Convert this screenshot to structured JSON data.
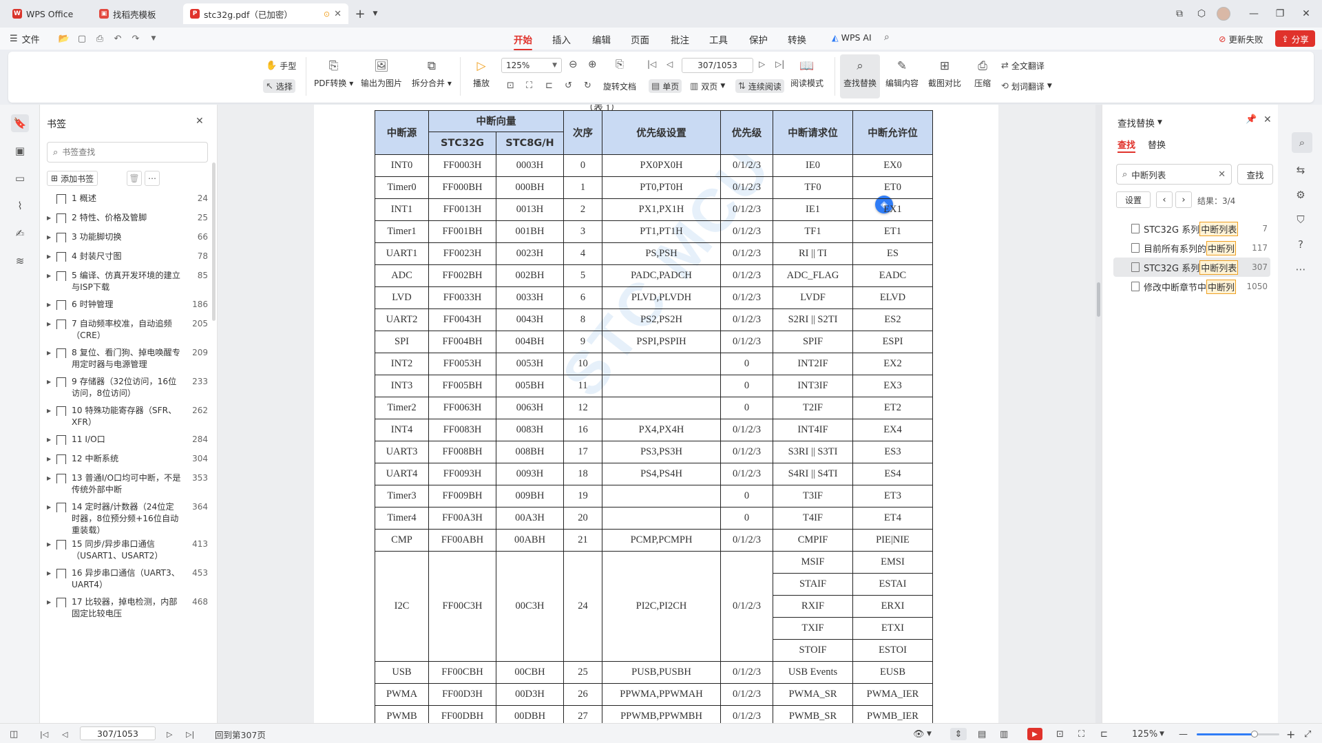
{
  "tabs": [
    {
      "label": "WPS Office",
      "icon": "wps-logo"
    },
    {
      "label": "找稻壳模板",
      "icon": "docer-logo"
    },
    {
      "label": "stc32g.pdf（已加密）",
      "icon": "pdf-logo"
    }
  ],
  "window": {
    "new_tab": "+"
  },
  "menubar": {
    "file": "文件",
    "items": [
      "开始",
      "插入",
      "编辑",
      "页面",
      "批注",
      "工具",
      "保护",
      "转换"
    ],
    "active": "开始",
    "wps_ai": "WPS AI",
    "update_failed": "更新失败",
    "share": "分享"
  },
  "ribbon": {
    "hand": "手型",
    "select": "选择",
    "pdf_convert": "PDF转换",
    "export_image": "输出为图片",
    "split_merge": "拆分合并",
    "play": "播放",
    "zoom": "125%",
    "page_field": "307/1053",
    "rotate": "旋转文档",
    "single_page": "单页",
    "double_page": "双页",
    "continuous": "连续阅读",
    "read_mode": "阅读模式",
    "find_replace": "查找替换",
    "edit_content": "编辑内容",
    "screenshot_compare": "截图对比",
    "compress": "压缩",
    "full_translate": "全文翻译",
    "word_translate": "划词翻译"
  },
  "bookmarks": {
    "title": "书签",
    "search_placeholder": "书签查找",
    "add": "添加书签",
    "items": [
      {
        "label": "1 概述",
        "page": "24",
        "expandable": false
      },
      {
        "label": "2 特性、价格及管脚",
        "page": "25",
        "expandable": true
      },
      {
        "label": "3 功能脚切换",
        "page": "66",
        "expandable": true
      },
      {
        "label": "4 封装尺寸图",
        "page": "78",
        "expandable": true
      },
      {
        "label": "5 编译、仿真开发环境的建立与ISP下载",
        "page": "85",
        "expandable": true
      },
      {
        "label": "6 时钟管理",
        "page": "186",
        "expandable": true
      },
      {
        "label": "7 自动频率校准，自动追频（CRE）",
        "page": "205",
        "expandable": true
      },
      {
        "label": "8 复位、看门狗、掉电唤醒专用定时器与电源管理",
        "page": "209",
        "expandable": true
      },
      {
        "label": "9 存储器（32位访问，16位访问，8位访问）",
        "page": "233",
        "expandable": true
      },
      {
        "label": "10 特殊功能寄存器（SFR、XFR）",
        "page": "262",
        "expandable": true
      },
      {
        "label": "11 I/O口",
        "page": "284",
        "expandable": true
      },
      {
        "label": "12 中断系统",
        "page": "304",
        "expandable": true
      },
      {
        "label": "13 普通I/O口均可中断，不是传统外部中断",
        "page": "353",
        "expandable": true
      },
      {
        "label": "14 定时器/计数器（24位定时器，8位预分频+16位自动重装载）",
        "page": "364",
        "expandable": true
      },
      {
        "label": "15 同步/异步串口通信（USART1、USART2）",
        "page": "413",
        "expandable": true
      },
      {
        "label": "16 异步串口通信（UART3、UART4）",
        "page": "453",
        "expandable": true
      },
      {
        "label": "17 比较器，掉电检测，内部固定比较电压",
        "page": "468",
        "expandable": true
      }
    ]
  },
  "document": {
    "caption_fragment": "（表 1）",
    "watermark": "STC MCU",
    "table": {
      "h_source": "中断源",
      "h_vector": "中断向量",
      "h_stc32g": "STC32G",
      "h_stc8": "STC8G/H",
      "h_order": "次序",
      "h_priority_set": "优先级设置",
      "h_priority": "优先级",
      "h_request": "中断请求位",
      "h_enable": "中断允许位",
      "rows": [
        [
          "INT0",
          "FF0003H",
          "0003H",
          "0",
          "PX0PX0H",
          "0/1/2/3",
          "IE0",
          "EX0"
        ],
        [
          "Timer0",
          "FF000BH",
          "000BH",
          "1",
          "PT0,PT0H",
          "0/1/2/3",
          "TF0",
          "ET0"
        ],
        [
          "INT1",
          "FF0013H",
          "0013H",
          "2",
          "PX1,PX1H",
          "0/1/2/3",
          "IE1",
          "EX1"
        ],
        [
          "Timer1",
          "FF001BH",
          "001BH",
          "3",
          "PT1,PT1H",
          "0/1/2/3",
          "TF1",
          "ET1"
        ],
        [
          "UART1",
          "FF0023H",
          "0023H",
          "4",
          "PS,PSH",
          "0/1/2/3",
          "RI || TI",
          "ES"
        ],
        [
          "ADC",
          "FF002BH",
          "002BH",
          "5",
          "PADC,PADCH",
          "0/1/2/3",
          "ADC_FLAG",
          "EADC"
        ],
        [
          "LVD",
          "FF0033H",
          "0033H",
          "6",
          "PLVD,PLVDH",
          "0/1/2/3",
          "LVDF",
          "ELVD"
        ],
        [
          "UART2",
          "FF0043H",
          "0043H",
          "8",
          "PS2,PS2H",
          "0/1/2/3",
          "S2RI || S2TI",
          "ES2"
        ],
        [
          "SPI",
          "FF004BH",
          "004BH",
          "9",
          "PSPI,PSPIH",
          "0/1/2/3",
          "SPIF",
          "ESPI"
        ],
        [
          "INT2",
          "FF0053H",
          "0053H",
          "10",
          "",
          "0",
          "INT2IF",
          "EX2"
        ],
        [
          "INT3",
          "FF005BH",
          "005BH",
          "11",
          "",
          "0",
          "INT3IF",
          "EX3"
        ],
        [
          "Timer2",
          "FF0063H",
          "0063H",
          "12",
          "",
          "0",
          "T2IF",
          "ET2"
        ],
        [
          "INT4",
          "FF0083H",
          "0083H",
          "16",
          "PX4,PX4H",
          "0/1/2/3",
          "INT4IF",
          "EX4"
        ],
        [
          "UART3",
          "FF008BH",
          "008BH",
          "17",
          "PS3,PS3H",
          "0/1/2/3",
          "S3RI || S3TI",
          "ES3"
        ],
        [
          "UART4",
          "FF0093H",
          "0093H",
          "18",
          "PS4,PS4H",
          "0/1/2/3",
          "S4RI || S4TI",
          "ES4"
        ],
        [
          "Timer3",
          "FF009BH",
          "009BH",
          "19",
          "",
          "0",
          "T3IF",
          "ET3"
        ],
        [
          "Timer4",
          "FF00A3H",
          "00A3H",
          "20",
          "",
          "0",
          "T4IF",
          "ET4"
        ],
        [
          "CMP",
          "FF00ABH",
          "00ABH",
          "21",
          "PCMP,PCMPH",
          "0/1/2/3",
          "CMPIF",
          "PIE|NIE"
        ]
      ],
      "i2c": {
        "source": "I2C",
        "stc32g": "FF00C3H",
        "stc8": "00C3H",
        "order": "24",
        "priority_set": "PI2C,PI2CH",
        "priority": "0/1/2/3",
        "sub": [
          [
            "MSIF",
            "EMSI"
          ],
          [
            "STAIF",
            "ESTAI"
          ],
          [
            "RXIF",
            "ERXI"
          ],
          [
            "TXIF",
            "ETXI"
          ],
          [
            "STOIF",
            "ESTOI"
          ]
        ]
      },
      "rows_after": [
        [
          "USB",
          "FF00CBH",
          "00CBH",
          "25",
          "PUSB,PUSBH",
          "0/1/2/3",
          "USB Events",
          "EUSB"
        ],
        [
          "PWMA",
          "FF00D3H",
          "00D3H",
          "26",
          "PPWMA,PPWMAH",
          "0/1/2/3",
          "PWMA_SR",
          "PWMA_IER"
        ],
        [
          "PWMB",
          "FF00DBH",
          "00DBH",
          "27",
          "PPWMB,PPWMBH",
          "0/1/2/3",
          "PWMB_SR",
          "PWMB_IER"
        ]
      ]
    }
  },
  "find_panel": {
    "title": "查找替换",
    "tab_find": "查找",
    "tab_replace": "替换",
    "query": "中断列表",
    "find_button": "查找",
    "settings": "设置",
    "result_count": "结果：3/4",
    "results": [
      {
        "prefix": "STC32G 系列",
        "hit": "中断列表",
        "page": "7",
        "selected": false
      },
      {
        "prefix": "目前所有系列的",
        "hit": "中断列",
        "page": "117",
        "selected": false
      },
      {
        "prefix": "STC32G 系列",
        "hit": "中断列表",
        "page": "307",
        "selected": true
      },
      {
        "prefix": "修改中断章节中",
        "hit": "中断列",
        "page": "1050",
        "selected": false
      }
    ]
  },
  "statusbar": {
    "page_field": "307/1053",
    "back_to_page": "回到第307页",
    "zoom": "125%",
    "zoom_fraction": 0.7
  },
  "colors": {
    "accent": "#e0322b",
    "table_header": "#c9daf3",
    "search_hit": "#f0a020",
    "ai_blue": "#2f7cf6"
  }
}
